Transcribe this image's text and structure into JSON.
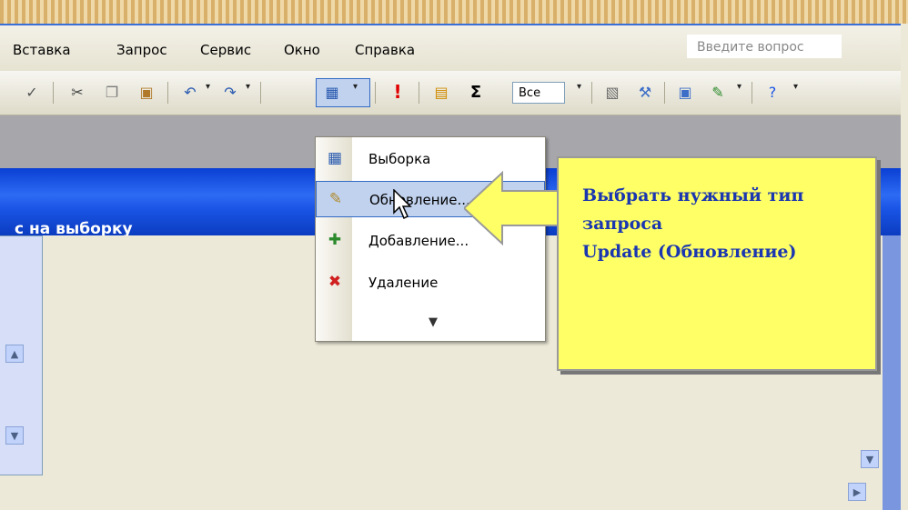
{
  "menubar": {
    "items": [
      {
        "label": "Вставка"
      },
      {
        "label": "Запрос"
      },
      {
        "label": "Сервис"
      },
      {
        "label": "Окно"
      },
      {
        "label": "Справка"
      }
    ],
    "ask_placeholder": "Введите вопрос"
  },
  "toolbar": {
    "combo_value": "Все",
    "icons": [
      "spellcheck-icon",
      "cut-icon",
      "copy-icon",
      "paste-icon",
      "undo-icon",
      "redo-icon",
      "query-type-icon",
      "run-icon",
      "show-table-icon",
      "totals-icon",
      "properties-icon",
      "builder-icon",
      "database-window-icon",
      "new-object-icon",
      "help-icon"
    ]
  },
  "document": {
    "title": "с на выборку"
  },
  "dropdown": {
    "items": [
      {
        "label": "Выборка",
        "icon": "select-query-icon"
      },
      {
        "label": "Обновление...",
        "icon": "update-query-icon"
      },
      {
        "label": "Добавление...",
        "icon": "append-query-icon"
      },
      {
        "label": "Удаление",
        "icon": "delete-query-icon"
      }
    ],
    "more": "»",
    "highlighted": 1
  },
  "callout": {
    "text": "Выбрать нужный тип\nзапроса\nUpdate (Обновление)"
  },
  "colors": {
    "titlebar": "#1a55e6",
    "highlight": "#c1d2ee",
    "callout_bg": "#ffff66",
    "callout_text": "#1a36b0"
  }
}
